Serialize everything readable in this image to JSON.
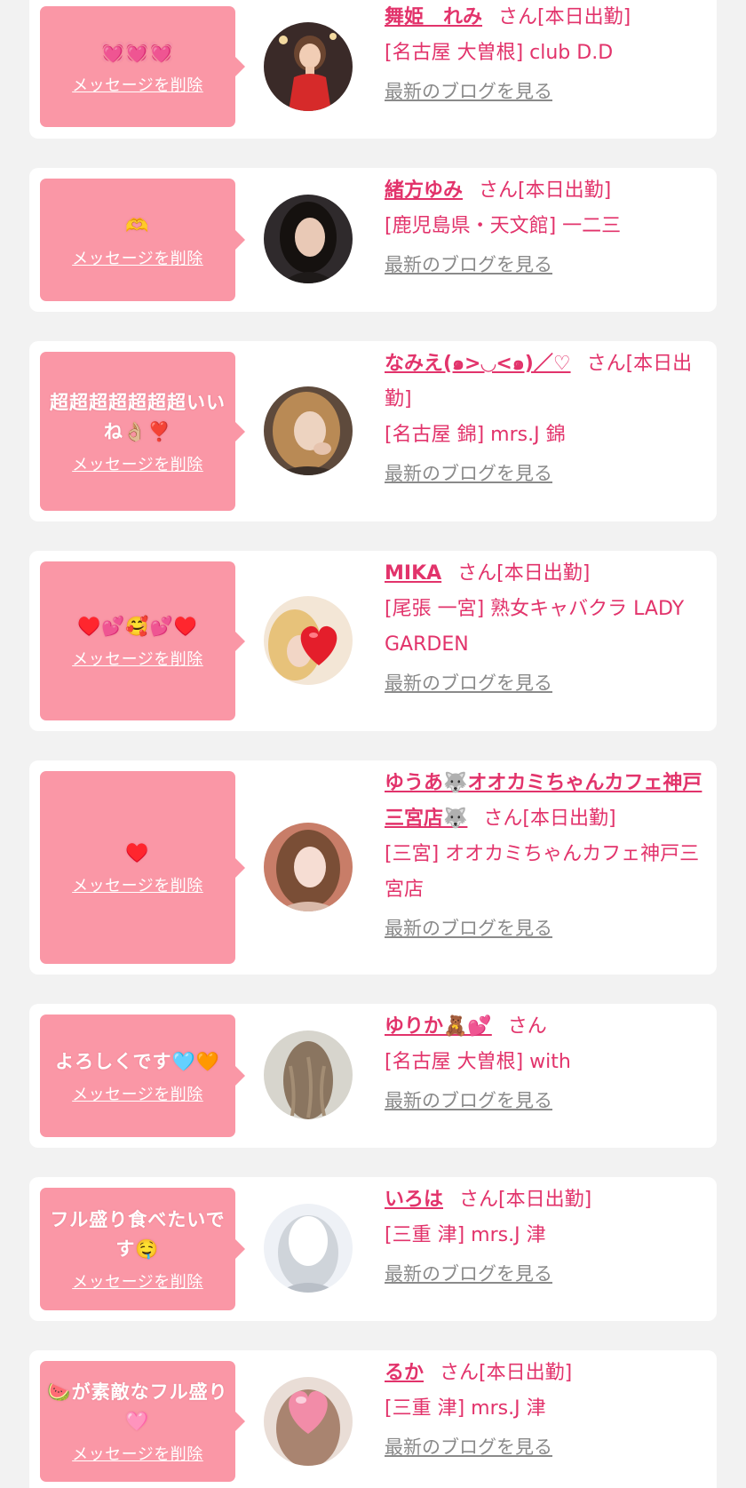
{
  "delete_label": "メッセージを削除",
  "blog_label": "最新のブログを見る",
  "san_label": "さん",
  "items": [
    {
      "message": "💓💓💓",
      "name": "舞姫　れみ",
      "status": "[本日出勤]",
      "shop": "[名古屋 大曽根] club D.D",
      "avatar": "photo-woman-red-dress"
    },
    {
      "message": "🫶",
      "name": "緒方ゆみ",
      "status": "[本日出勤]",
      "shop": "[鹿児島県・天文館] 一二三",
      "avatar": "photo-woman-dark-hair"
    },
    {
      "message": "超超超超超超超いいね👌🏼❣️",
      "name": "なみえ(๑>◡<๑)／♡",
      "status": "[本日出勤]",
      "shop": "[名古屋 錦] mrs.J 錦",
      "avatar": "photo-woman-blonde"
    },
    {
      "message": "♥️💕🥰💕♥️",
      "name": "MIKA",
      "status": "[本日出勤]",
      "shop": "[尾張 一宮] 熟女キャバクラ LADY GARDEN",
      "avatar": "photo-heart-covered-face"
    },
    {
      "message": "♥️",
      "name": "ゆうあ🐺オオカミちゃんカフェ神戸三宮店🐺",
      "status": "[本日出勤]",
      "shop": "[三宮] オオカミちゃんカフェ神戸三宮店",
      "avatar": "photo-woman-selfie"
    },
    {
      "message": "よろしくです🩵🧡",
      "name": "ゆりか🧸💕",
      "status": "",
      "shop": "[名古屋 大曽根] with",
      "avatar": "photo-hair-back"
    },
    {
      "message": "フル盛り食べたいです🤤",
      "name": "いろは",
      "status": "[本日出勤]",
      "shop": "[三重 津] mrs.J 津",
      "avatar": "photo-bright-blur"
    },
    {
      "message": "🍉が素敵なフル盛り🩷",
      "name": "るか",
      "status": "[本日出勤]",
      "shop": "[三重 津] mrs.J 津",
      "avatar": "photo-heart-covered-face-2"
    }
  ]
}
